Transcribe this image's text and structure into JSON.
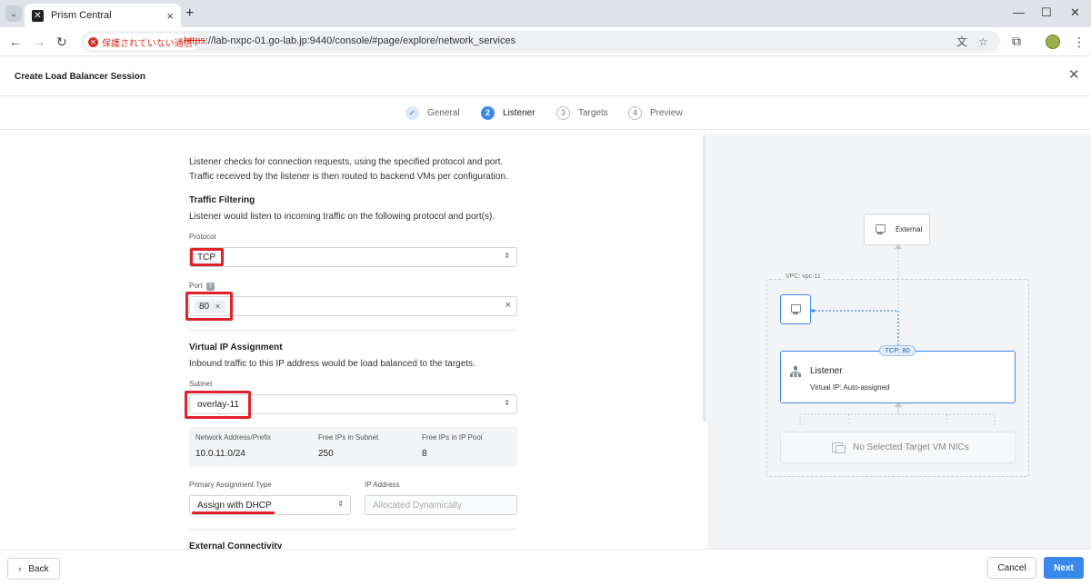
{
  "browser": {
    "tab_title": "Prism Central",
    "security_label": "保護されていない通信",
    "url_scheme": "https",
    "url_rest": "://lab-nxpc-01.go-lab.jp:9440/console/#page/explore/network_services"
  },
  "app": {
    "title": "Create Load Balancer Session"
  },
  "stepper": {
    "steps": [
      {
        "number": "✓",
        "label": "General",
        "state": "done"
      },
      {
        "number": "2",
        "label": "Listener",
        "state": "active"
      },
      {
        "number": "3",
        "label": "Targets",
        "state": "todo"
      },
      {
        "number": "4",
        "label": "Preview",
        "state": "todo"
      }
    ]
  },
  "form": {
    "intro_line1": "Listener checks for connection requests, using the specified protocol and port.",
    "intro_line2": "Traffic received by the listener is then routed to backend VMs per configuration.",
    "traffic_title": "Traffic Filtering",
    "traffic_desc": "Listener would listen to incoming traffic on the following protocol and port(s).",
    "protocol_label": "Protocol",
    "protocol_value": "TCP",
    "port_label": "Port",
    "port_help": "?",
    "port_value": "80",
    "vip_title": "Virtual IP Assignment",
    "vip_desc": "Inbound traffic to this IP address would be load balanced to the targets.",
    "subnet_label": "Subnet",
    "subnet_value": "overlay-11",
    "info": {
      "network_header": "Network Address/Prefix",
      "network_value": "10.0.11.0/24",
      "free_subnet_header": "Free IPs in Subnet",
      "free_subnet_value": "250",
      "free_pool_header": "Free IPs in IP Pool",
      "free_pool_value": "8"
    },
    "assignment_label": "Primary Assignment Type",
    "assignment_value": "Assign with DHCP",
    "ip_label": "IP Address",
    "ip_placeholder": "Allocated Dynamically",
    "external_title": "External Connectivity"
  },
  "diagram": {
    "external_label": "External",
    "vpc_label": "VPC: vpc-11",
    "tcp_badge": "TCP: 80",
    "listener_title": "Listener",
    "listener_sub": "Virtual IP: Auto-assigned",
    "targets_label": "No Selected Target VM NICs"
  },
  "footer": {
    "back_label": "Back",
    "cancel_label": "Cancel",
    "next_label": "Next"
  },
  "colors": {
    "accent": "#3a89ea",
    "highlight": "#e0222b"
  }
}
